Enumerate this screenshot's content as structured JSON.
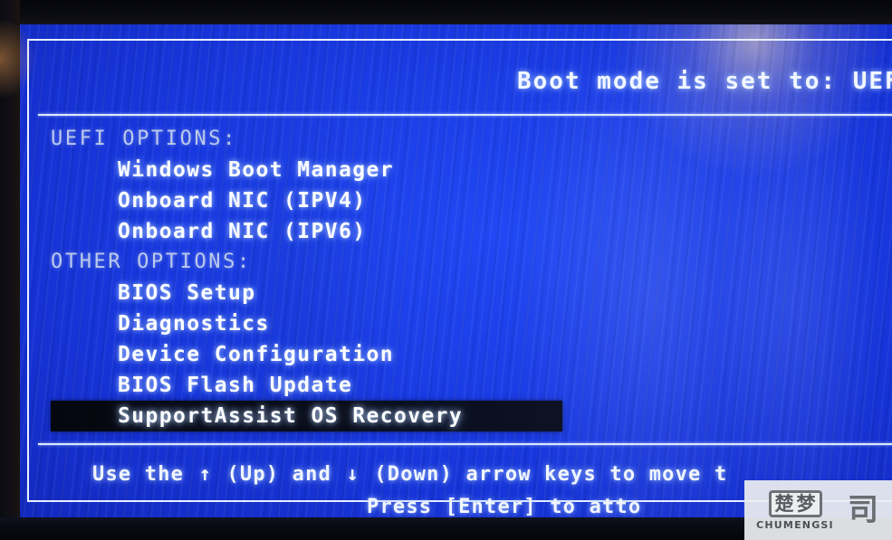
{
  "header": {
    "boot_mode_text": "Boot mode is set to: UEFI;"
  },
  "menu": {
    "uefi_section_label": "UEFI OPTIONS:",
    "uefi_options": [
      {
        "label": "Windows Boot Manager",
        "selected": false
      },
      {
        "label": "Onboard NIC (IPV4)",
        "selected": false
      },
      {
        "label": "Onboard NIC (IPV6)",
        "selected": false
      }
    ],
    "other_section_label": "OTHER OPTIONS:",
    "other_options": [
      {
        "label": "BIOS Setup",
        "selected": false
      },
      {
        "label": "Diagnostics",
        "selected": false
      },
      {
        "label": "Device Configuration",
        "selected": false
      },
      {
        "label": "BIOS Flash Update",
        "selected": false
      },
      {
        "label": "SupportAssist OS Recovery",
        "selected": true
      }
    ]
  },
  "footer": {
    "line1_part1": "Use the ",
    "line1_up_arrow": "↑",
    "line1_part2": " (Up) and ",
    "line1_down_arrow": "↓",
    "line1_part3": " (Down) arrow keys to move t",
    "line2": "Press [Enter] to atto  "
  },
  "watermark": {
    "cjk_1": "楚",
    "cjk_2": "梦",
    "cjk_3": "司",
    "name": "CHUMENGSI"
  },
  "colors": {
    "screen_blue": "#1B3DE6",
    "text_white": "#FAFCFF",
    "section_label": "#BCC9EC",
    "selection_bar": "#070A14",
    "frame_line": "#E8F0FF"
  }
}
